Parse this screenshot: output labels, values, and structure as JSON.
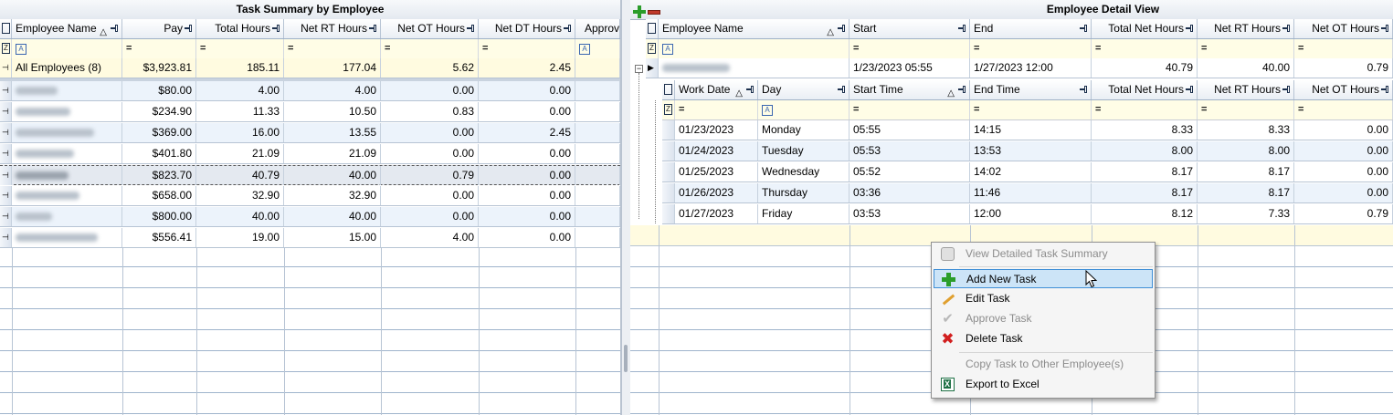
{
  "left_pane": {
    "title": "Task Summary by Employee",
    "columns": [
      {
        "label": "Employee Name",
        "sort": "△"
      },
      {
        "label": "Pay"
      },
      {
        "label": "Total Hours"
      },
      {
        "label": "Net RT Hours"
      },
      {
        "label": "Net OT Hours"
      },
      {
        "label": "Net DT Hours"
      },
      {
        "label": "Approv"
      }
    ],
    "filter_eq": "=",
    "filter_text": "A",
    "summary_row": {
      "name": "All Employees (8)",
      "pay": "$3,923.81",
      "total": "185.11",
      "rt": "177.04",
      "ot": "5.62",
      "dt": "2.45"
    },
    "rows": [
      {
        "pay": "$80.00",
        "total": "4.00",
        "rt": "4.00",
        "ot": "0.00",
        "dt": "0.00"
      },
      {
        "pay": "$234.90",
        "total": "11.33",
        "rt": "10.50",
        "ot": "0.83",
        "dt": "0.00"
      },
      {
        "pay": "$369.00",
        "total": "16.00",
        "rt": "13.55",
        "ot": "0.00",
        "dt": "2.45"
      },
      {
        "pay": "$401.80",
        "total": "21.09",
        "rt": "21.09",
        "ot": "0.00",
        "dt": "0.00"
      },
      {
        "pay": "$823.70",
        "total": "40.79",
        "rt": "40.00",
        "ot": "0.79",
        "dt": "0.00"
      },
      {
        "pay": "$658.00",
        "total": "32.90",
        "rt": "32.90",
        "ot": "0.00",
        "dt": "0.00"
      },
      {
        "pay": "$800.00",
        "total": "40.00",
        "rt": "40.00",
        "ot": "0.00",
        "dt": "0.00"
      },
      {
        "pay": "$556.41",
        "total": "19.00",
        "rt": "15.00",
        "ot": "4.00",
        "dt": "0.00"
      }
    ]
  },
  "right_pane": {
    "title": "Employee Detail View",
    "columns": [
      {
        "label": "Employee Name",
        "sort": "△"
      },
      {
        "label": "Start"
      },
      {
        "label": "End"
      },
      {
        "label": "Total Net Hours"
      },
      {
        "label": "Net RT Hours"
      },
      {
        "label": "Net OT Hours"
      }
    ],
    "employee_row": {
      "start": "1/23/2023 05:55",
      "end": "1/27/2023 12:00",
      "total": "40.79",
      "rt": "40.00",
      "ot": "0.79"
    },
    "detail_columns": [
      {
        "label": "Work Date",
        "sort": "△"
      },
      {
        "label": "Day"
      },
      {
        "label": "Start Time",
        "sort": "△"
      },
      {
        "label": "End Time"
      },
      {
        "label": "Total Net Hours"
      },
      {
        "label": "Net RT Hours"
      },
      {
        "label": "Net OT Hours"
      }
    ],
    "detail_rows": [
      {
        "date": "01/23/2023",
        "day": "Monday",
        "start": "05:55",
        "end": "14:15",
        "total": "8.33",
        "rt": "8.33",
        "ot": "0.00"
      },
      {
        "date": "01/24/2023",
        "day": "Tuesday",
        "start": "05:53",
        "end": "13:53",
        "total": "8.00",
        "rt": "8.00",
        "ot": "0.00"
      },
      {
        "date": "01/25/2023",
        "day": "Wednesday",
        "start": "05:52",
        "end": "14:02",
        "total": "8.17",
        "rt": "8.17",
        "ot": "0.00"
      },
      {
        "date": "01/26/2023",
        "day": "Thursday",
        "start": "03:36",
        "end": "11:46",
        "total": "8.17",
        "rt": "8.17",
        "ot": "0.00"
      },
      {
        "date": "01/27/2023",
        "day": "Friday",
        "start": "03:53",
        "end": "12:00",
        "total": "8.12",
        "rt": "7.33",
        "ot": "0.79"
      }
    ]
  },
  "context_menu": {
    "items": [
      {
        "label": "View Detailed Task Summary",
        "icon": "summary-icon",
        "enabled": false
      },
      {
        "label": "Add New Task",
        "icon": "plus-icon",
        "enabled": true,
        "hovered": true
      },
      {
        "label": "Edit Task",
        "icon": "pencil-icon",
        "enabled": true
      },
      {
        "label": "Approve Task",
        "icon": "check-icon",
        "enabled": false
      },
      {
        "label": "Delete Task",
        "icon": "x-icon",
        "enabled": true
      },
      {
        "label": "Copy Task to Other Employee(s)",
        "icon": "",
        "enabled": false
      },
      {
        "label": "Export to Excel",
        "icon": "excel-icon",
        "enabled": true
      }
    ]
  },
  "colors": {
    "summary_bg": "#fffbe0",
    "alt_row_bg": "#ecf3fb",
    "hover_bg": "#cce4f7"
  }
}
